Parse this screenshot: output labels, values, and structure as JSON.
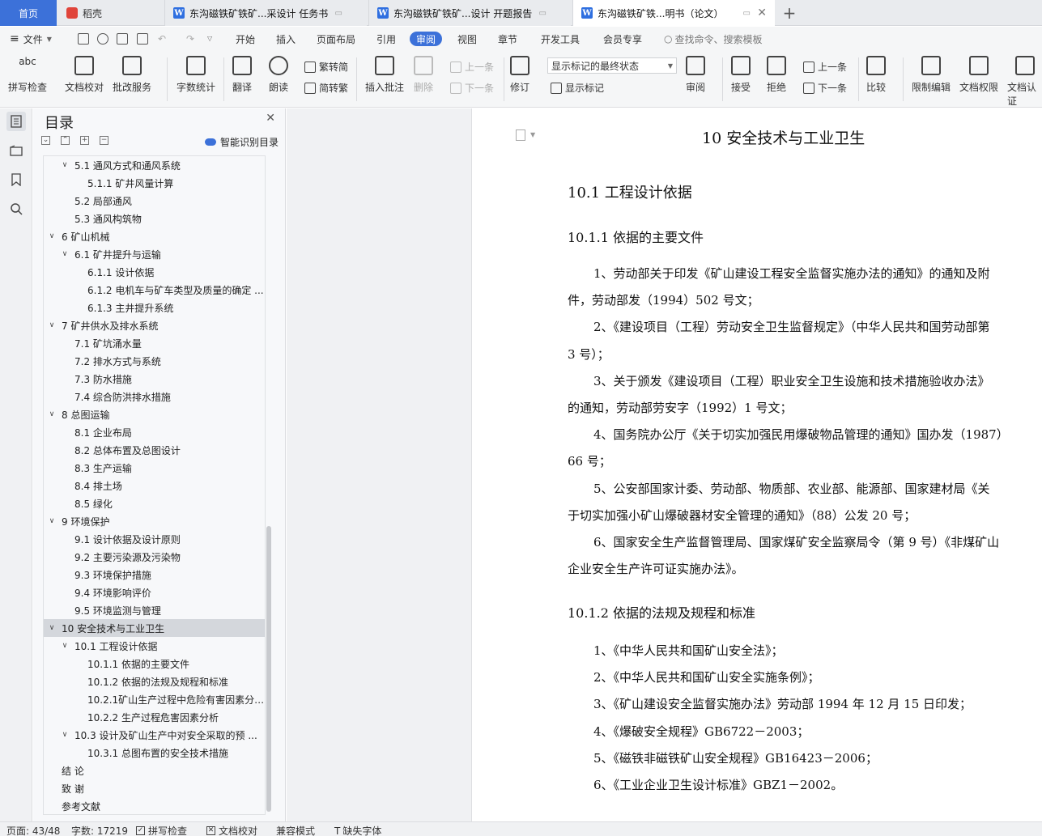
{
  "tabs": {
    "home": "首页",
    "draft": "稻壳",
    "doc1": "东沟磁铁矿铁矿...采设计 任务书",
    "doc2": "东沟磁铁矿铁矿...设计 开题报告",
    "doc3": "东沟磁铁矿铁...明书（论文）",
    "doc_icon_letter": "W"
  },
  "menu": {
    "file": "文件",
    "items": [
      "开始",
      "插入",
      "页面布局",
      "引用",
      "审阅",
      "视图",
      "章节",
      "开发工具",
      "会员专享"
    ],
    "active": "审阅",
    "search": "查找命令、搜索模板"
  },
  "ribbon": {
    "spell": "拼写检查",
    "proof": "文档校对",
    "batch": "批改服务",
    "wordcount": "字数统计",
    "translate": "翻译",
    "read": "朗读",
    "trad": "繁转简",
    "simp": "简转繁",
    "insert_comment": "插入批注",
    "delete": "删除",
    "prev": "上一条",
    "next": "下一条",
    "revise": "修订",
    "markup_state": "显示标记的最终状态",
    "show_markup": "显示标记",
    "review": "审阅",
    "accept": "接受",
    "reject": "拒绝",
    "prev2": "上一条",
    "next2": "下一条",
    "compare": "比较",
    "restrict": "限制编辑",
    "permission": "文档权限",
    "cert": "文档认证",
    "spell_icon_text": "abc"
  },
  "toc": {
    "title": "目录",
    "smart": "智能识别目录",
    "items": [
      {
        "label": "5.1  通风方式和通风系统",
        "level": 1,
        "toggle": "v"
      },
      {
        "label": "5.1.1  矿井风量计算",
        "level": 2,
        "toggle": ""
      },
      {
        "label": "5.2  局部通风",
        "level": 1,
        "toggle": ""
      },
      {
        "label": "5.3  通风构筑物",
        "level": 1,
        "toggle": ""
      },
      {
        "label": "6  矿山机械",
        "level": 0,
        "toggle": "v"
      },
      {
        "label": "6.1  矿井提升与运输",
        "level": 1,
        "toggle": "v"
      },
      {
        "label": "6.1.1  设计依据",
        "level": 2,
        "toggle": ""
      },
      {
        "label": "6.1.2  电机车与矿车类型及质量的确定 ...",
        "level": 2,
        "toggle": ""
      },
      {
        "label": "6.1.3  主井提升系统",
        "level": 2,
        "toggle": ""
      },
      {
        "label": "7  矿井供水及排水系统",
        "level": 0,
        "toggle": "v"
      },
      {
        "label": "7.1  矿坑涌水量",
        "level": 1,
        "toggle": ""
      },
      {
        "label": "7.2  排水方式与系统",
        "level": 1,
        "toggle": ""
      },
      {
        "label": "7.3  防水措施",
        "level": 1,
        "toggle": ""
      },
      {
        "label": "7.4  综合防洪排水措施",
        "level": 1,
        "toggle": ""
      },
      {
        "label": "8  总图运输",
        "level": 0,
        "toggle": "v"
      },
      {
        "label": "8.1  企业布局",
        "level": 1,
        "toggle": ""
      },
      {
        "label": "8.2  总体布置及总图设计",
        "level": 1,
        "toggle": ""
      },
      {
        "label": "8.3  生产运输",
        "level": 1,
        "toggle": ""
      },
      {
        "label": "8.4  排土场",
        "level": 1,
        "toggle": ""
      },
      {
        "label": "8.5  绿化",
        "level": 1,
        "toggle": ""
      },
      {
        "label": "9  环境保护",
        "level": 0,
        "toggle": "v"
      },
      {
        "label": "9.1  设计依据及设计原则",
        "level": 1,
        "toggle": ""
      },
      {
        "label": "9.2  主要污染源及污染物",
        "level": 1,
        "toggle": ""
      },
      {
        "label": "9.3  环境保护措施",
        "level": 1,
        "toggle": ""
      },
      {
        "label": "9.4  环境影响评价",
        "level": 1,
        "toggle": ""
      },
      {
        "label": "9.5  环境监测与管理",
        "level": 1,
        "toggle": ""
      },
      {
        "label": "10  安全技术与工业卫生",
        "level": 0,
        "toggle": "v",
        "selected": true
      },
      {
        "label": "10.1  工程设计依据",
        "level": 1,
        "toggle": "v"
      },
      {
        "label": "10.1.1  依据的主要文件",
        "level": 2,
        "toggle": ""
      },
      {
        "label": "10.1.2  依据的法规及规程和标准",
        "level": 2,
        "toggle": ""
      },
      {
        "label": "10.2.1矿山生产过程中危险有害因素分 ...",
        "level": 2,
        "toggle": ""
      },
      {
        "label": "10.2.2  生产过程危害因素分析",
        "level": 2,
        "toggle": ""
      },
      {
        "label": "10.3  设计及矿山生产中对安全采取的预 ...",
        "level": 1,
        "toggle": "v"
      },
      {
        "label": "10.3.1  总图布置的安全技术措施",
        "level": 2,
        "toggle": ""
      },
      {
        "label": "结    论",
        "level": 0,
        "toggle": ""
      },
      {
        "label": "致    谢",
        "level": 0,
        "toggle": ""
      },
      {
        "label": "参考文献",
        "level": 0,
        "toggle": ""
      }
    ]
  },
  "document": {
    "h1": "10  安全技术与工业卫生",
    "h2": "10.1  工程设计依据",
    "h3a": "10.1.1  依据的主要文件",
    "lines_a": [
      "1、劳动部关于印发《矿山建设工程安全监督实施办法的通知》的通知及附",
      "件，劳动部发（1994）502 号文；",
      "2、《建设项目（工程）劳动安全卫生监督规定》（中华人民共和国劳动部第",
      "3 号）；",
      "3、关于颁发《建设项目（工程）职业安全卫生设施和技术措施验收办法》",
      "的通知，劳动部劳安字（1992）1 号文；",
      "4、国务院办公厅《关于切实加强民用爆破物品管理的通知》国办发（1987）",
      "66 号；",
      "5、公安部国家计委、劳动部、物质部、农业部、能源部、国家建材局《关",
      "于切实加强小矿山爆破器材安全管理的通知》（88）公发 20 号；",
      "6、国家安全生产监督管理局、国家煤矿安全监察局令（第 9 号）《非煤矿山",
      "企业安全生产许可证实施办法》。"
    ],
    "h3b": "10.1.2  依据的法规及规程和标准",
    "lines_b": [
      "1、《中华人民共和国矿山安全法》；",
      "2、《中华人民共和国矿山安全实施条例》；",
      "3、《矿山建设安全监督实施办法》劳动部 1994 年 12 月 15 日印发；",
      "4、《爆破安全规程》GB6722－2003；",
      "5、《磁铁非磁铁矿山安全规程》GB16423－2006；",
      "6、《工业企业卫生设计标准》GBZ1－2002。"
    ]
  },
  "status": {
    "page": "页面: 43/48",
    "words": "字数: 17219",
    "spell": "拼写检查",
    "proof": "文档校对",
    "compat": "兼容模式",
    "missing_font": "缺失字体"
  }
}
